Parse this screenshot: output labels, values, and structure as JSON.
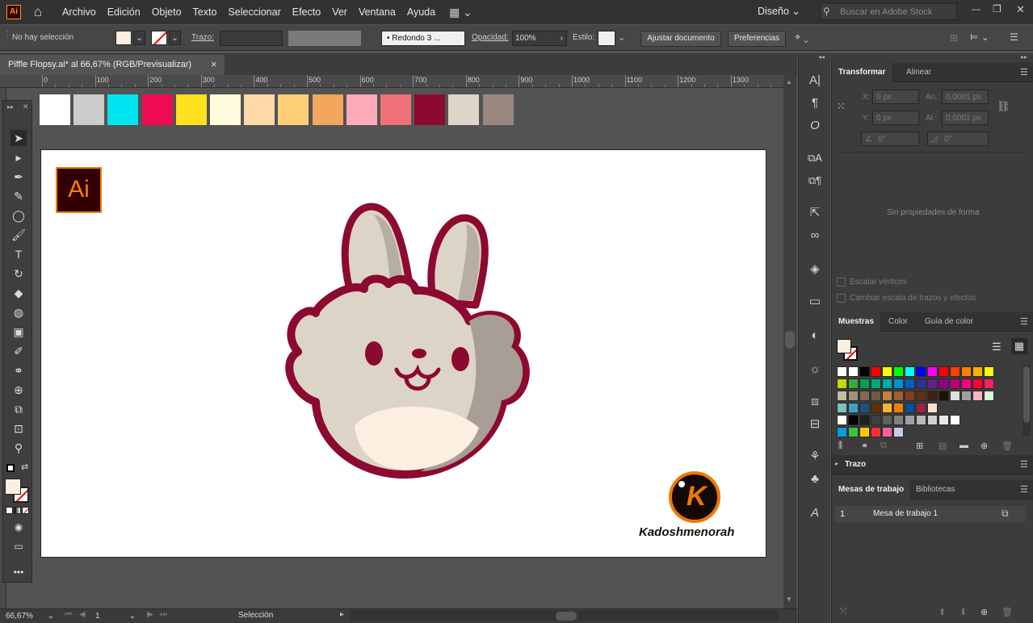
{
  "app": {
    "logo": "Ai"
  },
  "menu": [
    "Archivo",
    "Edición",
    "Objeto",
    "Texto",
    "Seleccionar",
    "Efecto",
    "Ver",
    "Ventana",
    "Ayuda"
  ],
  "workspace": {
    "label": "Diseño"
  },
  "search": {
    "placeholder": "Buscar en Adobe Stock"
  },
  "control": {
    "selection_status": "No hay selección",
    "stroke_label": "Trazo:",
    "brush_label": "Redondo 3 ...",
    "opacity_label": "Opacidad:",
    "opacity_value": "100%",
    "style_label": "Estilo:",
    "fit_document_button": "Ajustar documento",
    "preferences_button": "Preferencias"
  },
  "document": {
    "tab_title": "Piffle Flopsy.ai* al 66,67% (RGB/Previsualizar)",
    "close": "×"
  },
  "ruler": {
    "ticks": [
      "0",
      "100",
      "200",
      "300",
      "400",
      "500",
      "600",
      "700",
      "800",
      "900",
      "1000",
      "1100",
      "1200",
      "1300"
    ]
  },
  "canvas_swatches": [
    "#ffffff",
    "#cccccc",
    "#00e5f0",
    "#f00c55",
    "#ffe01e",
    "#fffcde",
    "#ffd9a8",
    "#ffcf78",
    "#f2a65e",
    "#ffaab8",
    "#f0707a",
    "#8c0a30",
    "#ddd5c8",
    "#9a8880"
  ],
  "artboard": {
    "badge": "Ai",
    "watermark_letter": "K",
    "watermark_text": "Kadoshmenorah"
  },
  "status": {
    "zoom": "66,67%",
    "artboard_num": "1",
    "tool_name": "Selección"
  },
  "panels": {
    "transform": {
      "tabs": [
        "Transformar",
        "Alinear"
      ],
      "x_label": "X:",
      "x_value": "0 px",
      "w_label": "An.:",
      "w_value": "0,0001 px",
      "y_label": "Y:",
      "y_value": "0 px",
      "h_label": "Al.:",
      "h_value": "0,0001 px",
      "rotate_value": "0°",
      "shear_value": "0°",
      "empty_message": "Sin propiedades de forma",
      "scale_corners": "Escalar vértices",
      "scale_strokes": "Cambiar escala de trazos y efectos"
    },
    "swatches": {
      "tabs": [
        "Muestras",
        "Color",
        "Guía de color"
      ]
    },
    "stroke": {
      "title": "Trazo"
    },
    "artboards": {
      "tabs": [
        "Mesas de trabajo",
        "Bibliotecas"
      ],
      "rows": [
        {
          "num": "1",
          "name": "Mesa de trabajo 1"
        }
      ]
    }
  },
  "swatch_grid": [
    [
      "#ffffff",
      "#ffffff",
      "#000000",
      "#ff0000",
      "#ffff00",
      "#00ff00",
      "#00ffff",
      "#0000ff",
      "#ff00ff",
      "#ff0000",
      "#ff4000",
      "#ff8000",
      "#ffb000",
      "#ffff00"
    ],
    [
      "#c8d800",
      "#3caa3c",
      "#00a050",
      "#00a878",
      "#00aaaa",
      "#0090d8",
      "#0060c0",
      "#303090",
      "#602090",
      "#900090",
      "#c00070",
      "#ff0080",
      "#ff0030",
      "#ff2060"
    ],
    [
      "#c0c0a0",
      "#a09080",
      "#806a50",
      "#705a40",
      "#c08040",
      "#a06030",
      "#804020",
      "#603010",
      "#402010",
      "#201008",
      "#e0e0e0",
      "#a0a0a0",
      "#ffb0c0",
      "#d0ffd0"
    ],
    [
      "#80c0c0",
      "#40a0c0",
      "#205080",
      "#603000",
      "#ffb030",
      "#f08000",
      "#0050a0",
      "#a02040",
      "#ffe0d0"
    ],
    [
      "#ffffff",
      "#000000",
      "#202020",
      "#404040",
      "#606060",
      "#808080",
      "#a0a0a0",
      "#b8b8b8",
      "#d0d0d0",
      "#e8e8e8",
      "#ffffff"
    ],
    [
      "#00a0e0",
      "#40c040",
      "#ffcc00",
      "#ff3030",
      "#ff60a0",
      "#c0d0e0"
    ]
  ]
}
